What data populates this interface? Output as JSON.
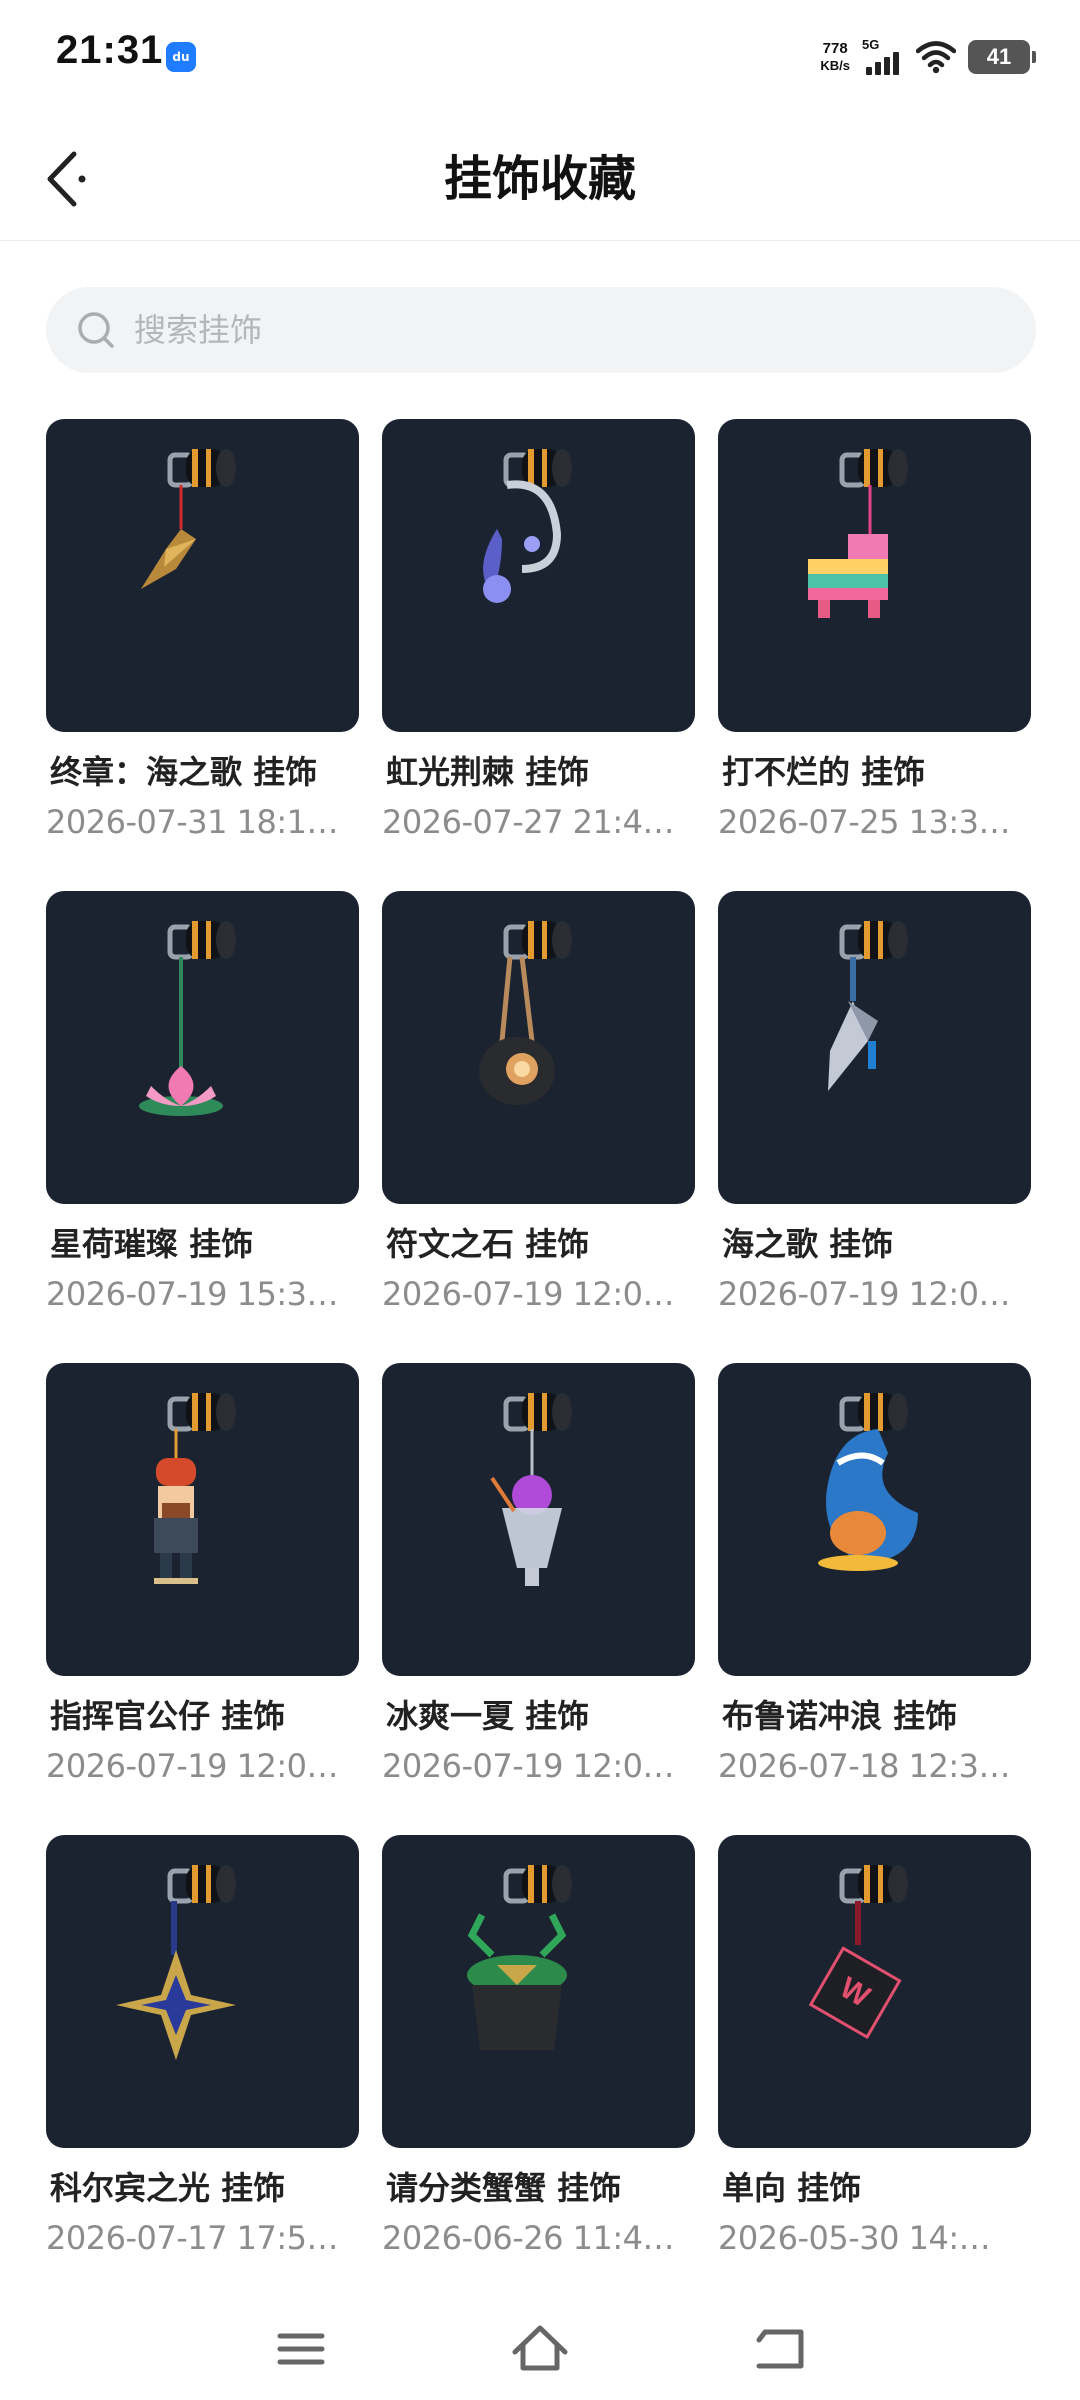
{
  "status_bar": {
    "time": "21:31",
    "app_icon": "du",
    "net_speed": "778",
    "net_speed_unit": "KB/s",
    "network": "5G",
    "battery": "41"
  },
  "header": {
    "title": "挂饰收藏"
  },
  "search": {
    "placeholder": "搜索挂饰"
  },
  "items": [
    {
      "name": "终章：海之歌 挂饰",
      "date": "2026-07-31 18:1…",
      "icon": "golden-shell-charm"
    },
    {
      "name": "虹光荆棘 挂饰",
      "date": "2026-07-27 21:4…",
      "icon": "silver-thorn-charm"
    },
    {
      "name": "打不烂的 挂饰",
      "date": "2026-07-25 13:3…",
      "icon": "pinata-llama-charm"
    },
    {
      "name": "星荷璀璨 挂饰",
      "date": "2026-07-19 15:3…",
      "icon": "lotus-charm"
    },
    {
      "name": "符文之石 挂饰",
      "date": "2026-07-19 12:0…",
      "icon": "rune-stone-charm"
    },
    {
      "name": "海之歌 挂饰",
      "date": "2026-07-19 12:0…",
      "icon": "conch-shell-charm"
    },
    {
      "name": "指挥官公仔 挂饰",
      "date": "2026-07-19 12:0…",
      "icon": "nutcracker-charm"
    },
    {
      "name": "冰爽一夏 挂饰",
      "date": "2026-07-19 12:0…",
      "icon": "ice-cream-charm"
    },
    {
      "name": "布鲁诺冲浪 挂饰",
      "date": "2026-07-18 12:3…",
      "icon": "surfing-fox-charm"
    },
    {
      "name": "科尔宾之光  挂饰",
      "date": "2026-07-17 17:5…",
      "icon": "star-gem-charm"
    },
    {
      "name": "请分类蟹蟹 挂饰",
      "date": "2026-06-26 11:4…",
      "icon": "crab-bucket-charm"
    },
    {
      "name": "单向 挂饰",
      "date": "2026-05-30 14:…",
      "icon": "w-tag-charm"
    }
  ]
}
